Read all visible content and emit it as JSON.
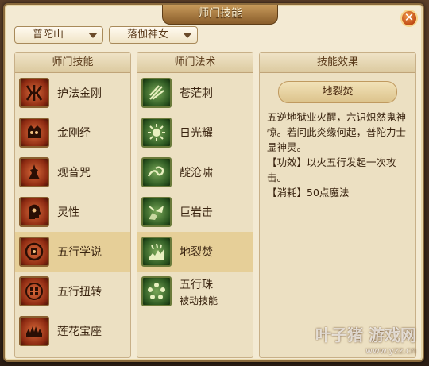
{
  "window": {
    "title": "师门技能",
    "close_glyph": "✕"
  },
  "filters": {
    "sect": {
      "value": "普陀山"
    },
    "master": {
      "value": "落伽神女"
    }
  },
  "panels": {
    "skills": {
      "header": "师门技能",
      "items": [
        {
          "label": "护法金刚",
          "icon": "vajra-guardian-icon"
        },
        {
          "label": "金刚经",
          "icon": "diamond-sutra-icon"
        },
        {
          "label": "观音咒",
          "icon": "guanyin-mantra-icon"
        },
        {
          "label": "灵性",
          "icon": "spirit-head-icon"
        },
        {
          "label": "五行学说",
          "icon": "five-elements-coin-icon",
          "selected": true
        },
        {
          "label": "五行扭转",
          "icon": "five-elements-twist-icon"
        },
        {
          "label": "莲花宝座",
          "icon": "lotus-throne-icon"
        }
      ]
    },
    "spells": {
      "header": "师门法术",
      "items": [
        {
          "label": "苍茫刺",
          "icon": "vast-thorn-icon"
        },
        {
          "label": "日光耀",
          "icon": "sunlight-icon"
        },
        {
          "label": "靛沧啸",
          "icon": "wave-roar-icon"
        },
        {
          "label": "巨岩击",
          "icon": "boulder-strike-icon"
        },
        {
          "label": "地裂焚",
          "icon": "earth-crack-fire-icon",
          "selected": true
        },
        {
          "label": "五行珠",
          "sub": "被动技能",
          "icon": "five-pearls-icon"
        }
      ]
    },
    "effect": {
      "header": "技能效果",
      "title": "地裂焚",
      "lines": [
        "五逆地狱业火醒，六识炽然鬼神惊。若问此炎缘何起，普陀力士显神灵。",
        "【功效】以火五行发起一次攻击。",
        "【消耗】50点魔法"
      ]
    }
  },
  "watermark": {
    "brand": "叶子猪 游戏网",
    "url": "www.yzz.cn"
  },
  "colors": {
    "panel_bg": "#ece0c2",
    "selected_row": "#e6cf98",
    "title_bar": "#8a5e2c",
    "close": "#c04a14"
  }
}
